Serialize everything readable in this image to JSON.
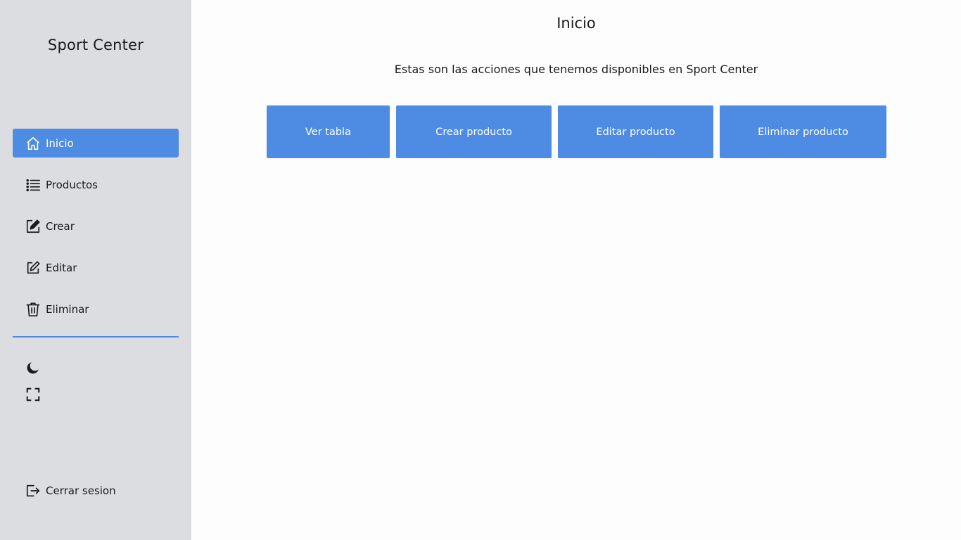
{
  "sidebar": {
    "brand": "Sport Center",
    "items": [
      {
        "label": "Inicio",
        "icon": "home-icon",
        "active": true
      },
      {
        "label": "Productos",
        "icon": "list-icon",
        "active": false
      },
      {
        "label": "Crear",
        "icon": "create-icon",
        "active": false
      },
      {
        "label": "Editar",
        "icon": "edit-icon",
        "active": false
      },
      {
        "label": "Eliminar",
        "icon": "trash-icon",
        "active": false
      }
    ],
    "utilities": [
      {
        "icon": "moon-icon"
      },
      {
        "icon": "fullscreen-icon"
      }
    ],
    "logout": {
      "label": "Cerrar sesion",
      "icon": "logout-icon"
    }
  },
  "main": {
    "title": "Inicio",
    "subtitle": "Estas son las acciones que tenemos disponibles en Sport Center",
    "actions": [
      {
        "label": "Ver tabla"
      },
      {
        "label": "Crear producto"
      },
      {
        "label": "Editar producto"
      },
      {
        "label": "Eliminar producto"
      }
    ]
  },
  "colors": {
    "accent": "#4e8be2",
    "sidebar_bg": "#dcdde1",
    "main_bg": "#fdfdfd",
    "text": "#1a1a1a"
  }
}
